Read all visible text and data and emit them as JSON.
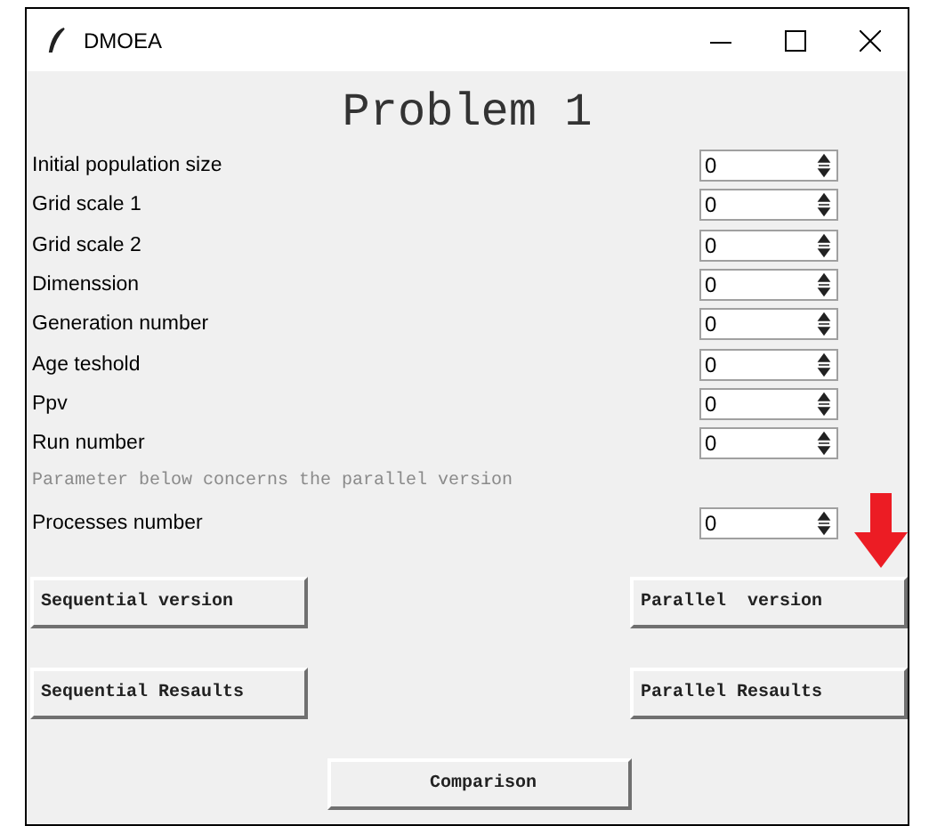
{
  "window": {
    "title": "DMOEA"
  },
  "heading": "Problem 1",
  "parameters": [
    {
      "label": "Initial population size",
      "value": "0"
    },
    {
      "label": "Grid scale 1",
      "value": "0"
    },
    {
      "label": "Grid scale 2",
      "value": "0"
    },
    {
      "label": "Dimenssion",
      "value": "0"
    },
    {
      "label": "Generation number",
      "value": "0"
    },
    {
      "label": "Age teshold",
      "value": "0"
    },
    {
      "label": "Ppv",
      "value": "0"
    },
    {
      "label": "Run number",
      "value": "0"
    }
  ],
  "note": "Parameter below concerns the parallel version",
  "parallel_parameters": [
    {
      "label": "Processes number",
      "value": "0"
    }
  ],
  "button_rows": [
    [
      "Sequential version",
      "Parallel  version"
    ],
    [
      "Sequential Resaults",
      "Parallel Resaults"
    ],
    [
      "Comparison"
    ]
  ]
}
